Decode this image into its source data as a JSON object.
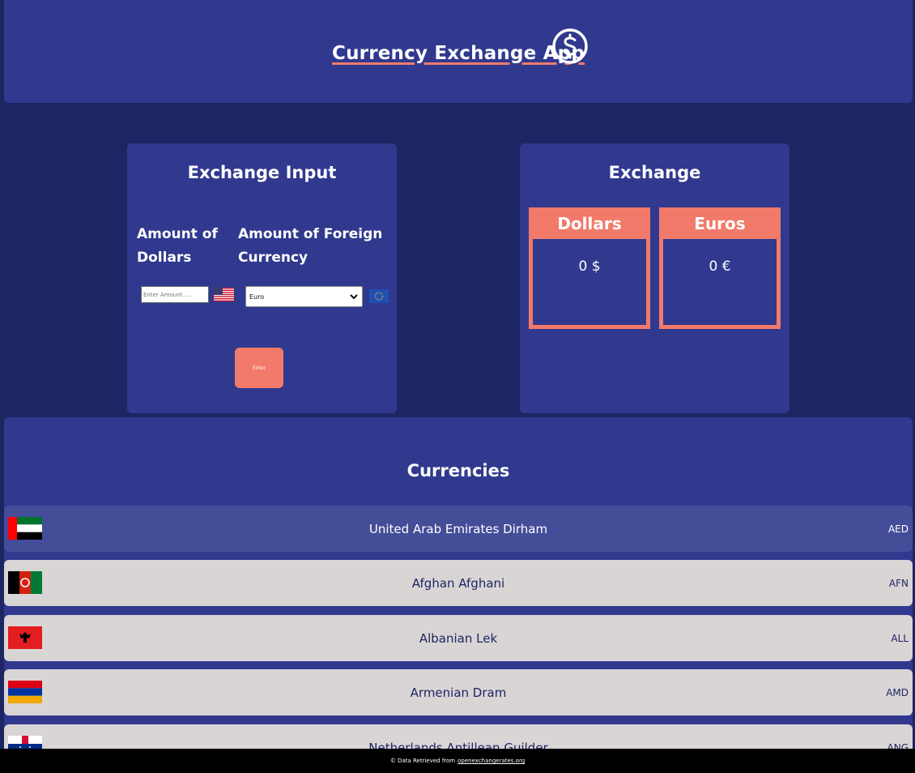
{
  "header": {
    "title": "Currency Exchange App",
    "icon": "dollar-circle-icon"
  },
  "input_panel": {
    "title": "Exchange Input",
    "dollars_label": "Amount of Dollars",
    "foreign_label": "Amount of Foreign Currency",
    "amount_placeholder": "Enter Amount.....",
    "amount_value": "",
    "selected_currency": "Euro",
    "enter_label": "Enter"
  },
  "exchange_panel": {
    "title": "Exchange",
    "dollars_header": "Dollars",
    "euros_header": "Euros",
    "dollars_value": "0 $",
    "euros_value": "0 €"
  },
  "currencies": {
    "title": "Currencies",
    "items": [
      {
        "name": "United Arab Emirates Dirham",
        "code": "AED",
        "flag": "uae-flag-icon",
        "selected": true
      },
      {
        "name": "Afghan Afghani",
        "code": "AFN",
        "flag": "afghanistan-flag-icon",
        "selected": false
      },
      {
        "name": "Albanian Lek",
        "code": "ALL",
        "flag": "albania-flag-icon",
        "selected": false
      },
      {
        "name": "Armenian Dram",
        "code": "AMD",
        "flag": "armenia-flag-icon",
        "selected": false
      },
      {
        "name": "Netherlands Antillean Guilder",
        "code": "ANG",
        "flag": "netherlands-antilles-flag-icon",
        "selected": false
      }
    ]
  },
  "footer": {
    "prefix": "© Data Retrieved from",
    "link": "openexchangerates.org"
  },
  "colors": {
    "background": "#1e2563",
    "panel": "#30398e",
    "accent": "#f27a6a",
    "row_light": "#d9d5d5",
    "row_selected": "#444d98"
  }
}
